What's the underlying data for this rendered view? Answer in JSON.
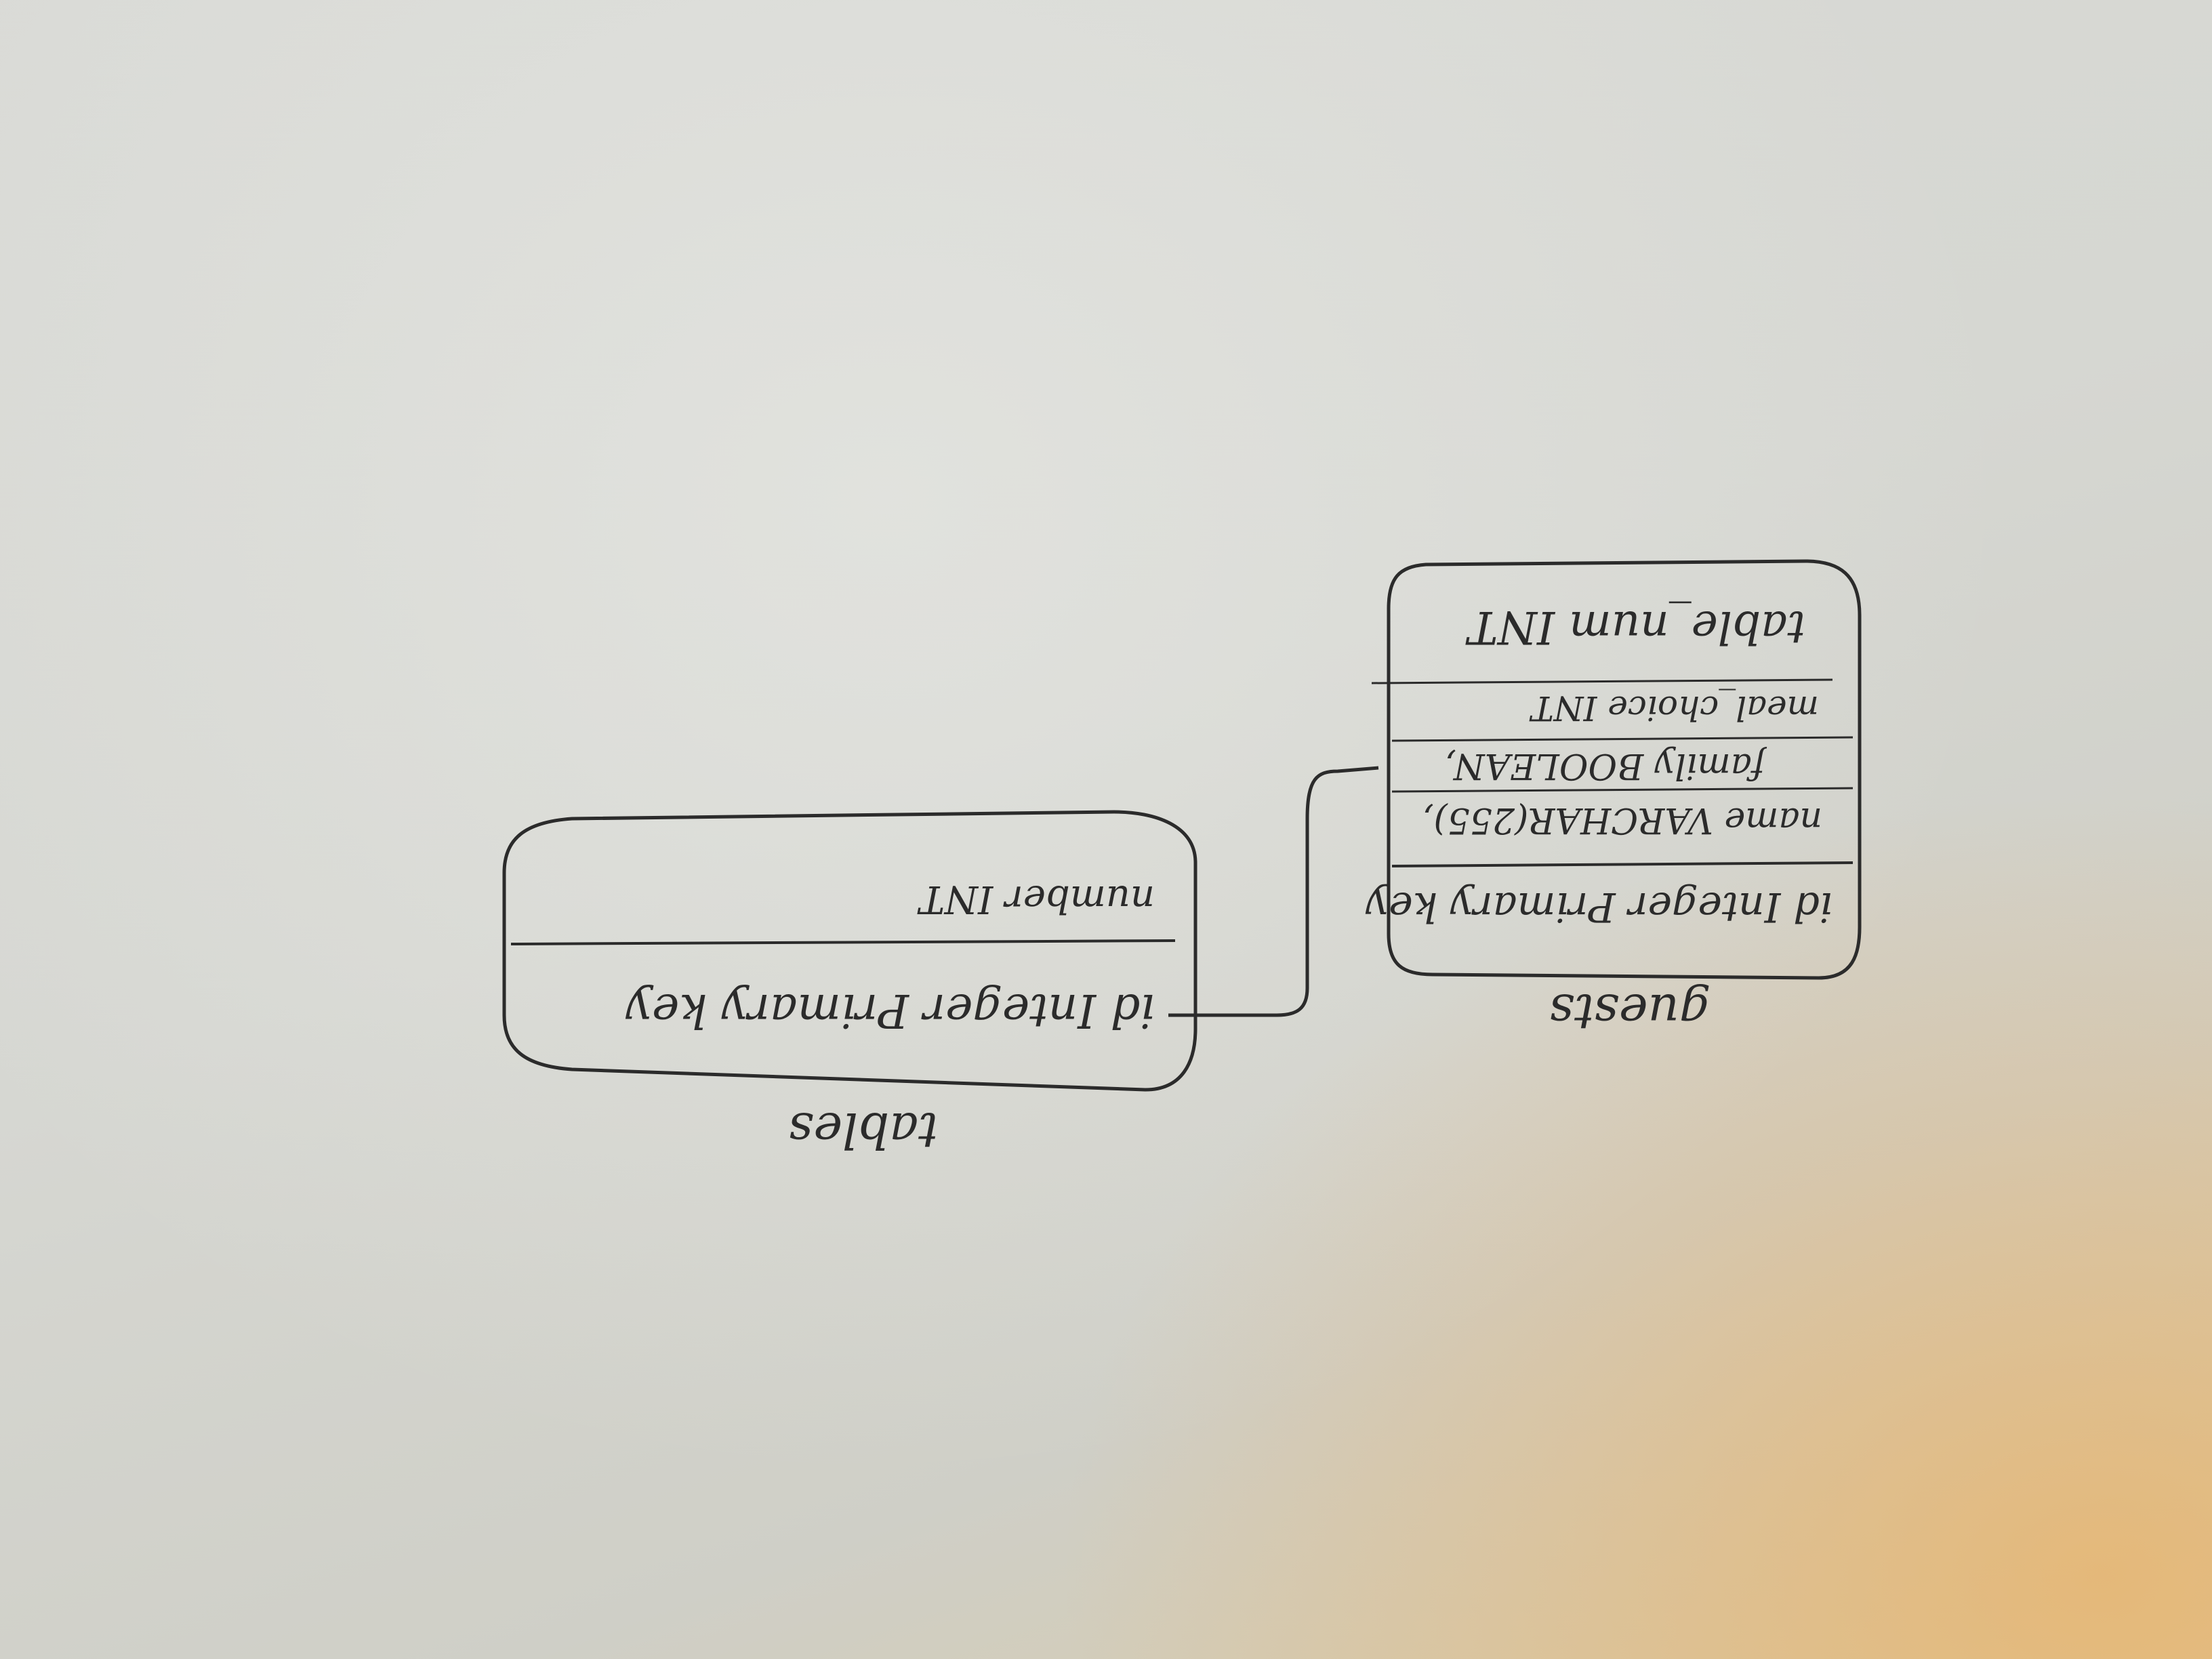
{
  "tables": [
    {
      "name": "tables",
      "fields": [
        "id Integer Primary key",
        "number INT"
      ]
    },
    {
      "name": "guests",
      "fields": [
        "id Integer Primary key",
        "name VARCHAR(255),",
        "family BOOLEAN,",
        "meal_choice INT",
        "table_num INT"
      ]
    }
  ],
  "relationship": {
    "from": "tables",
    "to": "guests"
  },
  "colors": {
    "ink": "#2b2b2b",
    "paper": "#d8d9d4"
  }
}
